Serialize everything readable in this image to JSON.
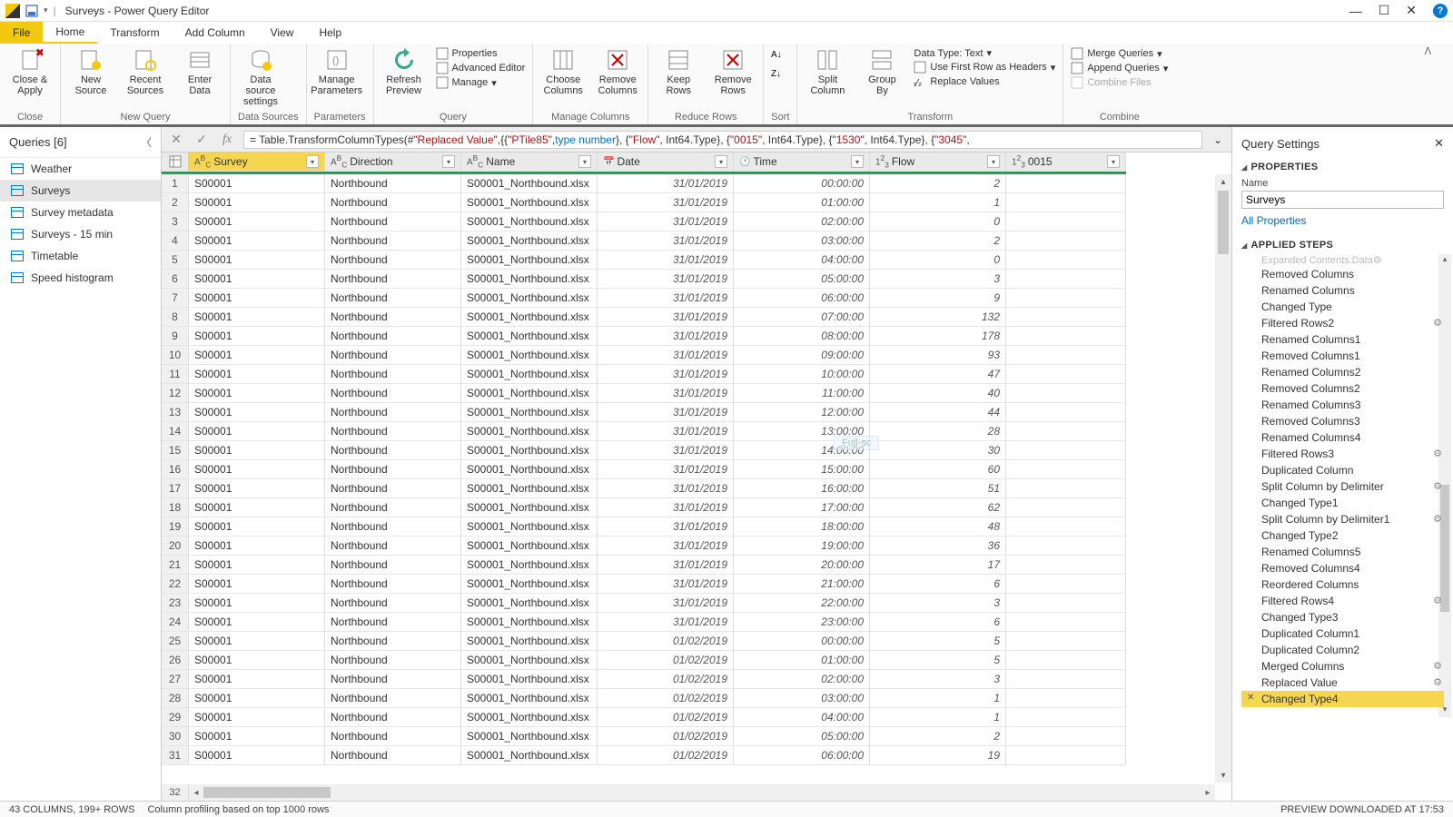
{
  "title": "Surveys - Power Query Editor",
  "menu": {
    "file": "File",
    "home": "Home",
    "transform": "Transform",
    "addcolumn": "Add Column",
    "view": "View",
    "help": "Help"
  },
  "ribbon": {
    "close": {
      "b1": "Close &\nApply",
      "grp": "Close"
    },
    "newquery": {
      "b1": "New\nSource",
      "b2": "Recent\nSources",
      "b3": "Enter\nData",
      "grp": "New Query"
    },
    "datasources": {
      "b1": "Data source\nsettings",
      "grp": "Data Sources"
    },
    "parameters": {
      "b1": "Manage\nParameters",
      "grp": "Parameters"
    },
    "query": {
      "b1": "Refresh\nPreview",
      "r1": "Properties",
      "r2": "Advanced Editor",
      "r3": "Manage",
      "grp": "Query"
    },
    "cols": {
      "b1": "Choose\nColumns",
      "b2": "Remove\nColumns",
      "grp": "Manage Columns"
    },
    "rows": {
      "b1": "Keep\nRows",
      "b2": "Remove\nRows",
      "grp": "Reduce Rows"
    },
    "sort": {
      "grp": "Sort"
    },
    "transform": {
      "b1": "Split\nColumn",
      "b2": "Group\nBy",
      "r1": "Data Type: Text",
      "r2": "Use First Row as Headers",
      "r3": "Replace Values",
      "grp": "Transform"
    },
    "combine": {
      "r1": "Merge Queries",
      "r2": "Append Queries",
      "r3": "Combine Files",
      "grp": "Combine"
    }
  },
  "queries": {
    "title": "Queries [6]",
    "items": [
      "Weather",
      "Surveys",
      "Survey metadata",
      "Surveys - 15 min",
      "Timetable",
      "Speed histogram"
    ],
    "selected": 1
  },
  "formula": {
    "prefix": "= Table.TransformColumnTypes(#",
    "s1": "\"Replaced Value\"",
    "mid1": ",{{",
    "s2": "\"PTile85\"",
    "mid2": ", ",
    "kw": "type number",
    "mid3": "}, {",
    "s3": "\"Flow\"",
    "mid4": ", Int64.Type}, {",
    "s4": "\"0015\"",
    "mid5": ", Int64.Type}, {",
    "s5": "\"1530\"",
    "mid6": ", Int64.Type}, {",
    "s6": "\"3045\"",
    "mid7": ","
  },
  "columns": [
    "Survey",
    "Direction",
    "Name",
    "Date",
    "Time",
    "Flow",
    "0015"
  ],
  "coltypes": [
    "ABC",
    "ABC",
    "ABC",
    "date",
    "clock",
    "123",
    "123"
  ],
  "rows": [
    {
      "n": 1,
      "s": "S00001",
      "d": "Northbound",
      "nm": "S00001_Northbound.xlsx",
      "dt": "31/01/2019",
      "tm": "00:00:00",
      "f": "2",
      "c15": ""
    },
    {
      "n": 2,
      "s": "S00001",
      "d": "Northbound",
      "nm": "S00001_Northbound.xlsx",
      "dt": "31/01/2019",
      "tm": "01:00:00",
      "f": "1",
      "c15": ""
    },
    {
      "n": 3,
      "s": "S00001",
      "d": "Northbound",
      "nm": "S00001_Northbound.xlsx",
      "dt": "31/01/2019",
      "tm": "02:00:00",
      "f": "0",
      "c15": ""
    },
    {
      "n": 4,
      "s": "S00001",
      "d": "Northbound",
      "nm": "S00001_Northbound.xlsx",
      "dt": "31/01/2019",
      "tm": "03:00:00",
      "f": "2",
      "c15": ""
    },
    {
      "n": 5,
      "s": "S00001",
      "d": "Northbound",
      "nm": "S00001_Northbound.xlsx",
      "dt": "31/01/2019",
      "tm": "04:00:00",
      "f": "0",
      "c15": ""
    },
    {
      "n": 6,
      "s": "S00001",
      "d": "Northbound",
      "nm": "S00001_Northbound.xlsx",
      "dt": "31/01/2019",
      "tm": "05:00:00",
      "f": "3",
      "c15": ""
    },
    {
      "n": 7,
      "s": "S00001",
      "d": "Northbound",
      "nm": "S00001_Northbound.xlsx",
      "dt": "31/01/2019",
      "tm": "06:00:00",
      "f": "9",
      "c15": ""
    },
    {
      "n": 8,
      "s": "S00001",
      "d": "Northbound",
      "nm": "S00001_Northbound.xlsx",
      "dt": "31/01/2019",
      "tm": "07:00:00",
      "f": "132",
      "c15": ""
    },
    {
      "n": 9,
      "s": "S00001",
      "d": "Northbound",
      "nm": "S00001_Northbound.xlsx",
      "dt": "31/01/2019",
      "tm": "08:00:00",
      "f": "178",
      "c15": ""
    },
    {
      "n": 10,
      "s": "S00001",
      "d": "Northbound",
      "nm": "S00001_Northbound.xlsx",
      "dt": "31/01/2019",
      "tm": "09:00:00",
      "f": "93",
      "c15": ""
    },
    {
      "n": 11,
      "s": "S00001",
      "d": "Northbound",
      "nm": "S00001_Northbound.xlsx",
      "dt": "31/01/2019",
      "tm": "10:00:00",
      "f": "47",
      "c15": ""
    },
    {
      "n": 12,
      "s": "S00001",
      "d": "Northbound",
      "nm": "S00001_Northbound.xlsx",
      "dt": "31/01/2019",
      "tm": "11:00:00",
      "f": "40",
      "c15": ""
    },
    {
      "n": 13,
      "s": "S00001",
      "d": "Northbound",
      "nm": "S00001_Northbound.xlsx",
      "dt": "31/01/2019",
      "tm": "12:00:00",
      "f": "44",
      "c15": ""
    },
    {
      "n": 14,
      "s": "S00001",
      "d": "Northbound",
      "nm": "S00001_Northbound.xlsx",
      "dt": "31/01/2019",
      "tm": "13:00:00",
      "f": "28",
      "c15": ""
    },
    {
      "n": 15,
      "s": "S00001",
      "d": "Northbound",
      "nm": "S00001_Northbound.xlsx",
      "dt": "31/01/2019",
      "tm": "14:00:00",
      "f": "30",
      "c15": ""
    },
    {
      "n": 16,
      "s": "S00001",
      "d": "Northbound",
      "nm": "S00001_Northbound.xlsx",
      "dt": "31/01/2019",
      "tm": "15:00:00",
      "f": "60",
      "c15": ""
    },
    {
      "n": 17,
      "s": "S00001",
      "d": "Northbound",
      "nm": "S00001_Northbound.xlsx",
      "dt": "31/01/2019",
      "tm": "16:00:00",
      "f": "51",
      "c15": ""
    },
    {
      "n": 18,
      "s": "S00001",
      "d": "Northbound",
      "nm": "S00001_Northbound.xlsx",
      "dt": "31/01/2019",
      "tm": "17:00:00",
      "f": "62",
      "c15": ""
    },
    {
      "n": 19,
      "s": "S00001",
      "d": "Northbound",
      "nm": "S00001_Northbound.xlsx",
      "dt": "31/01/2019",
      "tm": "18:00:00",
      "f": "48",
      "c15": ""
    },
    {
      "n": 20,
      "s": "S00001",
      "d": "Northbound",
      "nm": "S00001_Northbound.xlsx",
      "dt": "31/01/2019",
      "tm": "19:00:00",
      "f": "36",
      "c15": ""
    },
    {
      "n": 21,
      "s": "S00001",
      "d": "Northbound",
      "nm": "S00001_Northbound.xlsx",
      "dt": "31/01/2019",
      "tm": "20:00:00",
      "f": "17",
      "c15": ""
    },
    {
      "n": 22,
      "s": "S00001",
      "d": "Northbound",
      "nm": "S00001_Northbound.xlsx",
      "dt": "31/01/2019",
      "tm": "21:00:00",
      "f": "6",
      "c15": ""
    },
    {
      "n": 23,
      "s": "S00001",
      "d": "Northbound",
      "nm": "S00001_Northbound.xlsx",
      "dt": "31/01/2019",
      "tm": "22:00:00",
      "f": "3",
      "c15": ""
    },
    {
      "n": 24,
      "s": "S00001",
      "d": "Northbound",
      "nm": "S00001_Northbound.xlsx",
      "dt": "31/01/2019",
      "tm": "23:00:00",
      "f": "6",
      "c15": ""
    },
    {
      "n": 25,
      "s": "S00001",
      "d": "Northbound",
      "nm": "S00001_Northbound.xlsx",
      "dt": "01/02/2019",
      "tm": "00:00:00",
      "f": "5",
      "c15": ""
    },
    {
      "n": 26,
      "s": "S00001",
      "d": "Northbound",
      "nm": "S00001_Northbound.xlsx",
      "dt": "01/02/2019",
      "tm": "01:00:00",
      "f": "5",
      "c15": ""
    },
    {
      "n": 27,
      "s": "S00001",
      "d": "Northbound",
      "nm": "S00001_Northbound.xlsx",
      "dt": "01/02/2019",
      "tm": "02:00:00",
      "f": "3",
      "c15": ""
    },
    {
      "n": 28,
      "s": "S00001",
      "d": "Northbound",
      "nm": "S00001_Northbound.xlsx",
      "dt": "01/02/2019",
      "tm": "03:00:00",
      "f": "1",
      "c15": ""
    },
    {
      "n": 29,
      "s": "S00001",
      "d": "Northbound",
      "nm": "S00001_Northbound.xlsx",
      "dt": "01/02/2019",
      "tm": "04:00:00",
      "f": "1",
      "c15": ""
    },
    {
      "n": 30,
      "s": "S00001",
      "d": "Northbound",
      "nm": "S00001_Northbound.xlsx",
      "dt": "01/02/2019",
      "tm": "05:00:00",
      "f": "2",
      "c15": ""
    },
    {
      "n": 31,
      "s": "S00001",
      "d": "Northbound",
      "nm": "S00001_Northbound.xlsx",
      "dt": "01/02/2019",
      "tm": "06:00:00",
      "f": "19",
      "c15": ""
    }
  ],
  "lastnum": "32",
  "settings": {
    "title": "Query Settings",
    "properties": "PROPERTIES",
    "namelabel": "Name",
    "name": "Surveys",
    "allprops": "All Properties",
    "applied": "APPLIED STEPS",
    "cut": "Expanded Contents.Data",
    "steps": [
      {
        "t": "Removed Columns"
      },
      {
        "t": "Renamed Columns"
      },
      {
        "t": "Changed Type"
      },
      {
        "t": "Filtered Rows2",
        "g": true
      },
      {
        "t": "Renamed Columns1"
      },
      {
        "t": "Removed Columns1"
      },
      {
        "t": "Renamed Columns2"
      },
      {
        "t": "Removed Columns2"
      },
      {
        "t": "Renamed Columns3"
      },
      {
        "t": "Removed Columns3"
      },
      {
        "t": "Renamed Columns4"
      },
      {
        "t": "Filtered Rows3",
        "g": true
      },
      {
        "t": "Duplicated Column"
      },
      {
        "t": "Split Column by Delimiter",
        "g": true
      },
      {
        "t": "Changed Type1"
      },
      {
        "t": "Split Column by Delimiter1",
        "g": true
      },
      {
        "t": "Changed Type2"
      },
      {
        "t": "Renamed Columns5"
      },
      {
        "t": "Removed Columns4"
      },
      {
        "t": "Reordered Columns"
      },
      {
        "t": "Filtered Rows4",
        "g": true
      },
      {
        "t": "Changed Type3"
      },
      {
        "t": "Duplicated Column1"
      },
      {
        "t": "Duplicated Column2"
      },
      {
        "t": "Merged Columns",
        "g": true
      },
      {
        "t": "Replaced Value",
        "g": true
      },
      {
        "t": "Changed Type4",
        "sel": true
      }
    ]
  },
  "status": {
    "left": "43 COLUMNS, 199+ ROWS",
    "mid": "Column profiling based on top 1000 rows",
    "right": "PREVIEW DOWNLOADED AT 17:53"
  },
  "tooltip": "Full-sc"
}
